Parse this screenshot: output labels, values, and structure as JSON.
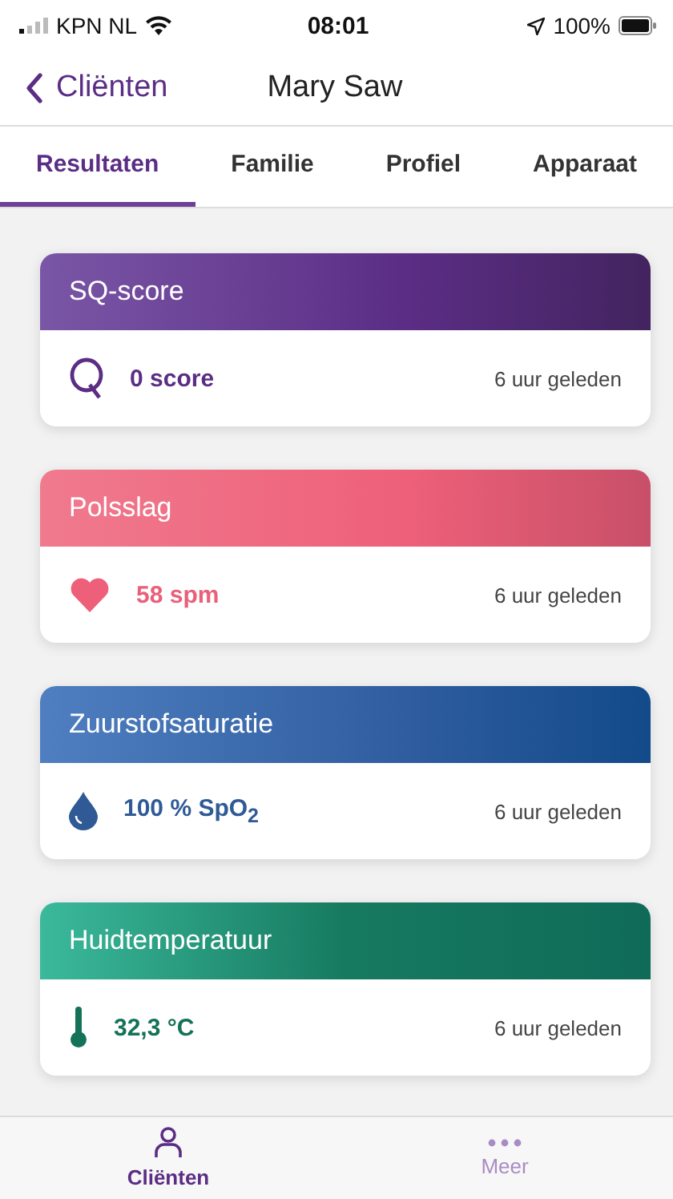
{
  "status_bar": {
    "carrier": "KPN NL",
    "time": "08:01",
    "battery": "100%"
  },
  "nav": {
    "back": "Cliënten",
    "title": "Mary Saw"
  },
  "tabs": [
    {
      "label": "Resultaten",
      "selected": true
    },
    {
      "label": "Familie",
      "selected": false
    },
    {
      "label": "Profiel",
      "selected": false
    },
    {
      "label": "Apparaat",
      "selected": false
    }
  ],
  "cards": [
    {
      "kind": "score",
      "title": "SQ-score",
      "value": "0 score",
      "time": "6 uur geleden"
    },
    {
      "kind": "pulse",
      "title": "Polsslag",
      "value": "58 spm",
      "time": "6 uur geleden"
    },
    {
      "kind": "oxygen",
      "title": "Zuurstofsaturatie",
      "value": "100 % SpO$_{2}$",
      "time": "6 uur geleden"
    },
    {
      "kind": "temperature",
      "title": "Huidtemperatuur",
      "value": "32,3 °C",
      "time": "6 uur geleden"
    }
  ],
  "bottom_nav": [
    {
      "kind": "person",
      "label": "Cliënten",
      "selected": true
    },
    {
      "kind": "more",
      "label": "Meer",
      "selected": false
    }
  ]
}
